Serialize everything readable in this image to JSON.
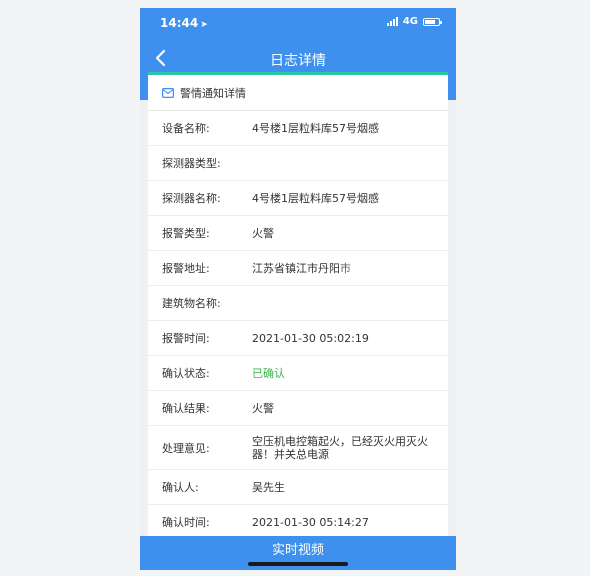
{
  "status_bar": {
    "time": "14:44",
    "location_arrow": "➤",
    "network": "4G"
  },
  "nav": {
    "title": "日志详情"
  },
  "card": {
    "header": "警情通知详情",
    "rows": [
      {
        "label": "设备名称:",
        "value": "4号楼1层粒料库57号烟感"
      },
      {
        "label": "探测器类型:",
        "value": ""
      },
      {
        "label": "探测器名称:",
        "value": "4号楼1层粒料库57号烟感"
      },
      {
        "label": "报警类型:",
        "value": "火警"
      },
      {
        "label": "报警地址:",
        "value": "江苏省镇江市丹阳市"
      },
      {
        "label": "建筑物名称:",
        "value": ""
      },
      {
        "label": "报警时间:",
        "value": "2021-01-30 05:02:19"
      },
      {
        "label": "确认状态:",
        "value": "已确认"
      },
      {
        "label": "确认结果:",
        "value": "火警"
      },
      {
        "label": "处理意见:",
        "value": "空压机电控箱起火，已经灭火用灭火器！并关总电源"
      },
      {
        "label": "确认人:",
        "value": "吴先生"
      },
      {
        "label": "确认时间:",
        "value": "2021-01-30 05:14:27"
      }
    ]
  },
  "bottom_button": {
    "label": "实时视频"
  },
  "colors": {
    "primary": "#3d90ee",
    "accent_line": "#2ec7a4",
    "confirmed": "#3bb34a"
  },
  "icons": {
    "back": "chevron-left-icon",
    "header": "envelope-icon"
  }
}
